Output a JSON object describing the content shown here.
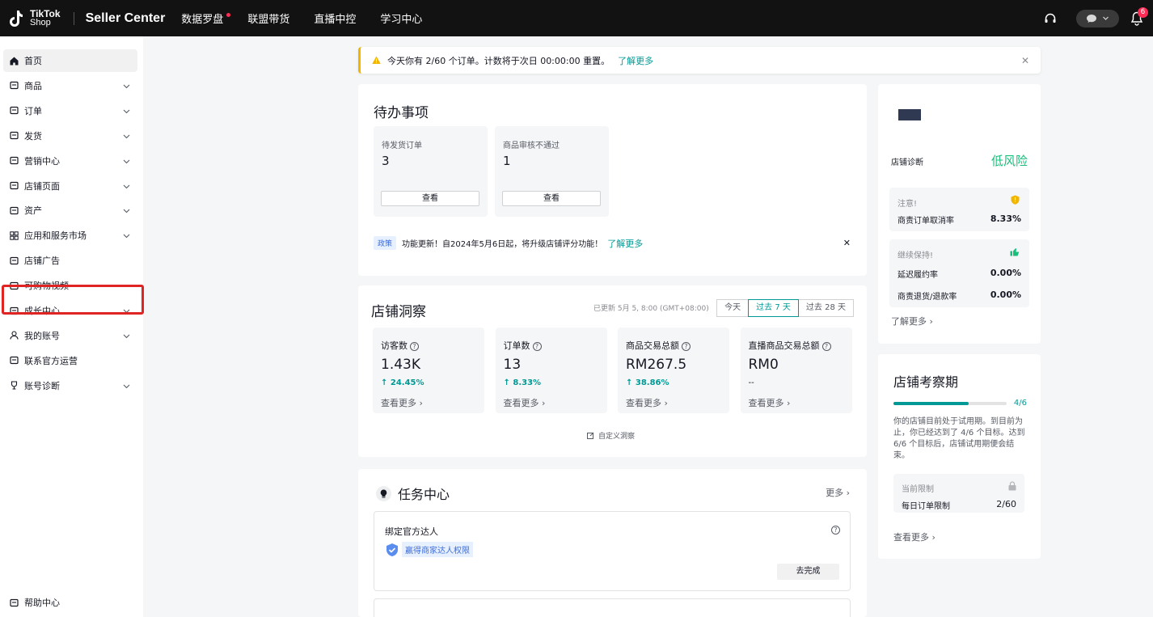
{
  "topbar": {
    "logo_line1": "TikTok",
    "logo_line2": "Shop",
    "title": "Seller Center",
    "nav": [
      "数据罗盘",
      "联盟带货",
      "直播中控",
      "学习中心"
    ],
    "bell_badge": "6"
  },
  "sidebar": {
    "items": [
      {
        "label": "首页",
        "icon": "home-icon",
        "chevron": false
      },
      {
        "label": "商品",
        "icon": "product-icon",
        "chevron": true
      },
      {
        "label": "订单",
        "icon": "order-icon",
        "chevron": true
      },
      {
        "label": "发货",
        "icon": "truck-icon",
        "chevron": true
      },
      {
        "label": "营销中心",
        "icon": "megaphone-icon",
        "chevron": true
      },
      {
        "label": "店铺页面",
        "icon": "store-icon",
        "chevron": true
      },
      {
        "label": "资产",
        "icon": "wallet-icon",
        "chevron": true
      },
      {
        "label": "应用和服务市场",
        "icon": "apps-icon",
        "chevron": true
      },
      {
        "label": "店铺广告",
        "icon": "ads-icon",
        "chevron": false
      },
      {
        "label": "可购物视频",
        "icon": "video-icon",
        "chevron": false
      },
      {
        "label": "成长中心",
        "icon": "medal-icon",
        "chevron": true
      },
      {
        "label": "我的账号",
        "icon": "user-icon",
        "chevron": true
      },
      {
        "label": "联系官方运营",
        "icon": "contact-icon",
        "chevron": false
      },
      {
        "label": "账号诊断",
        "icon": "trophy-icon",
        "chevron": true
      }
    ],
    "help": "帮助中心"
  },
  "notice": {
    "text": "今天你有 2/60 个订单。计数将于次日 00:00:00 重置。",
    "link": "了解更多"
  },
  "todo": {
    "title": "待办事项",
    "boxes": [
      {
        "label": "待发货订单",
        "value": "3",
        "button": "查看"
      },
      {
        "label": "商品审核不通过",
        "value": "1",
        "button": "查看"
      }
    ],
    "policy_tag": "政策",
    "policy_text": "功能更新！自2024年5月6日起，将升级店铺评分功能！",
    "policy_link": "了解更多"
  },
  "insight": {
    "title": "店铺洞察",
    "updated": "已更新 5月 5, 8:00 (GMT+08:00)",
    "ranges": [
      "今天",
      "过去 7 天",
      "过去 28 天"
    ],
    "metrics": [
      {
        "label": "访客数",
        "value": "1.43K",
        "change": "24.45%",
        "more": "查看更多"
      },
      {
        "label": "订单数",
        "value": "13",
        "change": "8.33%",
        "more": "查看更多"
      },
      {
        "label": "商品交易总额",
        "value": "RM267.5",
        "change": "38.86%",
        "more": "查看更多"
      },
      {
        "label": "直播商品交易总额",
        "value": "RM0",
        "change": "--",
        "more": "查看更多"
      }
    ],
    "customize": "自定义洞察"
  },
  "tasks": {
    "title": "任务中心",
    "more": "更多",
    "task_title": "绑定官方达人",
    "task_tag": "赢得商家达人权限",
    "task_button": "去完成"
  },
  "diagnosis": {
    "label": "店铺诊断",
    "risk": "低风险",
    "warn_title": "注意!",
    "warn_key": "商责订单取消率",
    "warn_val": "8.33%",
    "keep_title": "继续保持!",
    "keep_rows": [
      {
        "key": "延迟履约率",
        "val": "0.00%"
      },
      {
        "key": "商责退货/退款率",
        "val": "0.00%"
      }
    ],
    "more": "了解更多"
  },
  "probation": {
    "title": "店铺考察期",
    "progress_label": "4/6",
    "progress": 0.6667,
    "desc": "你的店铺目前处于试用期。到目前为止，你已经达到了 4/6 个目标。达到 6/6 个目标后，店铺试用期便会结束。",
    "limit_title": "当前限制",
    "limit_key": "每日订单限制",
    "limit_val": "2/60",
    "more": "查看更多"
  },
  "colors": {
    "accent": "#009995",
    "risk": "#16c07a",
    "highlight": "#e02424"
  }
}
